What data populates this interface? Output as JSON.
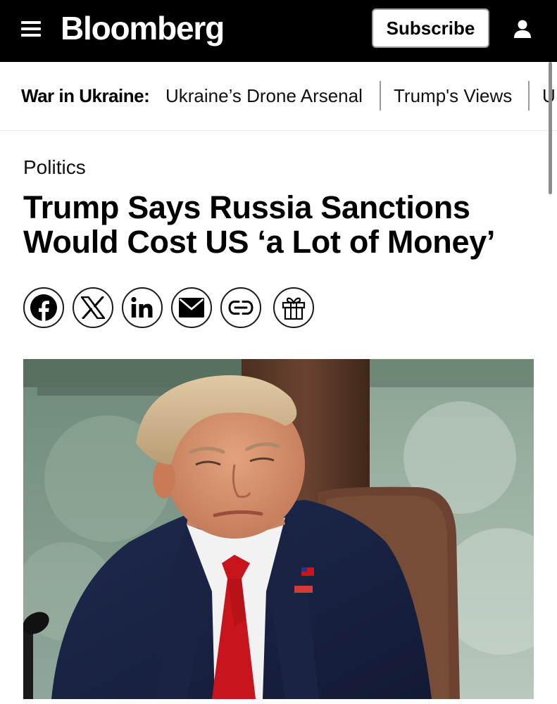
{
  "header": {
    "logo": "Bloomberg",
    "subscribe_label": "Subscribe",
    "menu_icon": "hamburger-menu-icon",
    "account_icon": "user-icon"
  },
  "topics": {
    "label": "War in Ukraine:",
    "links": [
      "Ukraine’s Drone Arsenal",
      "Trump's Views",
      "U"
    ]
  },
  "article": {
    "category": "Politics",
    "headline": "Trump Says Russia Sanctions Would Cost US ‘a Lot of Money’",
    "share_icons": [
      "facebook-icon",
      "x-icon",
      "linkedin-icon",
      "email-icon",
      "link-icon",
      "gift-icon"
    ]
  },
  "colors": {
    "header_bg": "#000000",
    "accent": "#ffffff"
  }
}
